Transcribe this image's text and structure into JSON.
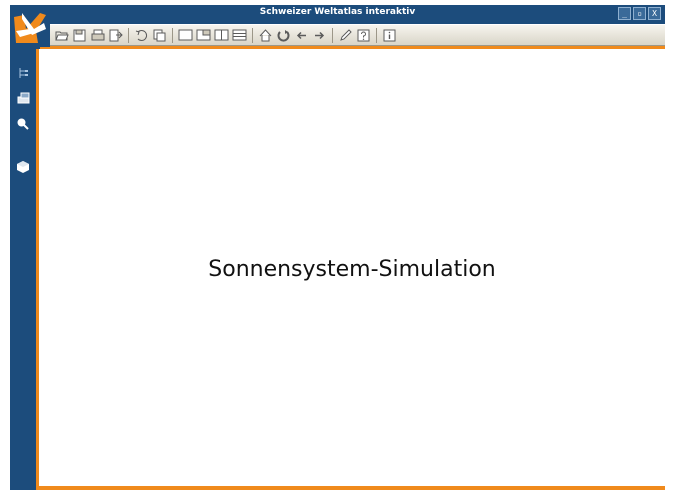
{
  "window": {
    "title": "Schweizer Weltatlas interaktiv",
    "controls": [
      "_",
      "▫",
      "X"
    ]
  },
  "toolbar": {
    "icons": [
      "open-folder-icon",
      "save-icon",
      "print-icon",
      "export-icon",
      "rotate-icon",
      "copy-icon",
      "single-view-icon",
      "window-split-icon",
      "two-column-icon",
      "row-split-icon",
      "home-icon",
      "refresh-icon",
      "back-arrow-icon",
      "forward-arrow-icon",
      "pen-icon",
      "help-icon",
      "info-icon"
    ]
  },
  "sidebar": {
    "icons": [
      "tree-icon",
      "layers-icon",
      "zoom-icon",
      "globe-icon"
    ]
  },
  "content": {
    "title": "Sonnensystem-Simulation"
  },
  "colors": {
    "frame": "#1c4c7c",
    "accent": "#f08a1c",
    "toolbar": "#e8e5dc"
  }
}
